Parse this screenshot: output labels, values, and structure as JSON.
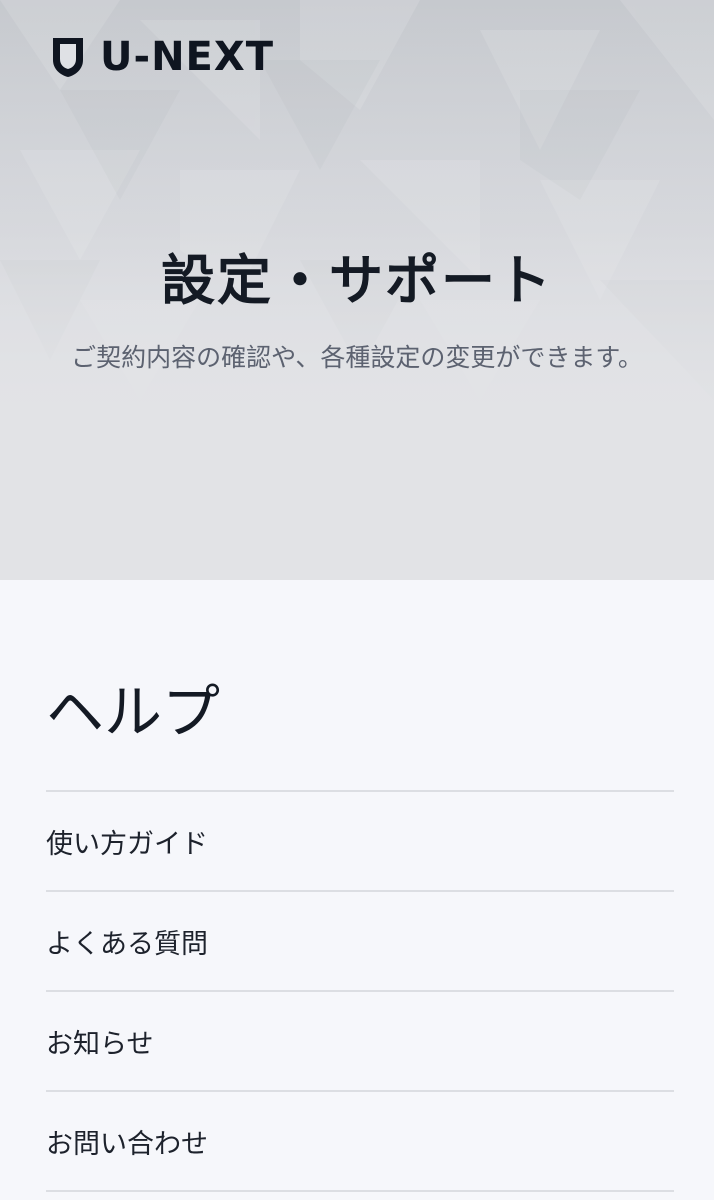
{
  "header": {
    "logo_text": "U-NEXT",
    "title": "設定・サポート",
    "subtitle": "ご契約内容の確認や、各種設定の変更ができます。"
  },
  "help": {
    "title": "ヘルプ",
    "items": [
      {
        "label": "使い方ガイド"
      },
      {
        "label": "よくある質問"
      },
      {
        "label": "お知らせ"
      },
      {
        "label": "お問い合わせ"
      }
    ]
  },
  "colors": {
    "background": "#f6f7fb",
    "hero_gray": "#e2e3e6",
    "text_dark": "#141a24",
    "divider": "#dcdee3"
  },
  "icons": {
    "logo": "shield-logo-icon"
  }
}
